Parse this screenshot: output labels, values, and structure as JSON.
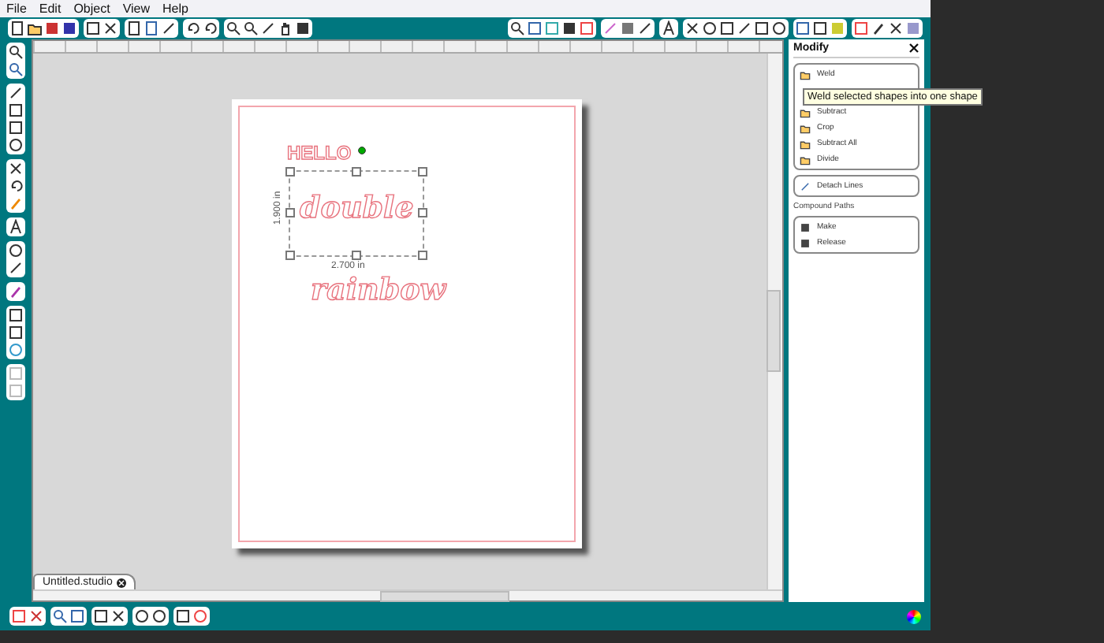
{
  "menu": [
    "File",
    "Edit",
    "Object",
    "View",
    "Help"
  ],
  "canvas": {
    "texts": [
      {
        "kind": "block",
        "text": "HELLO"
      },
      {
        "kind": "script",
        "text": "double"
      },
      {
        "kind": "script",
        "text": "rainbow"
      }
    ],
    "height_label": "1.900 in",
    "width_label": "2.700 in"
  },
  "document_tab": {
    "label": "Untitled.studio"
  },
  "panel": {
    "title": "Modify",
    "groups": [
      {
        "items": [
          "Weld",
          "Subtract",
          "Crop",
          "Subtract All",
          "Divide"
        ]
      },
      {
        "items": [
          "Detach Lines"
        ]
      },
      {
        "heading": "Compound Paths",
        "items": [
          "Make",
          "Release"
        ]
      }
    ]
  },
  "tooltip": "Weld selected shapes into one shape"
}
